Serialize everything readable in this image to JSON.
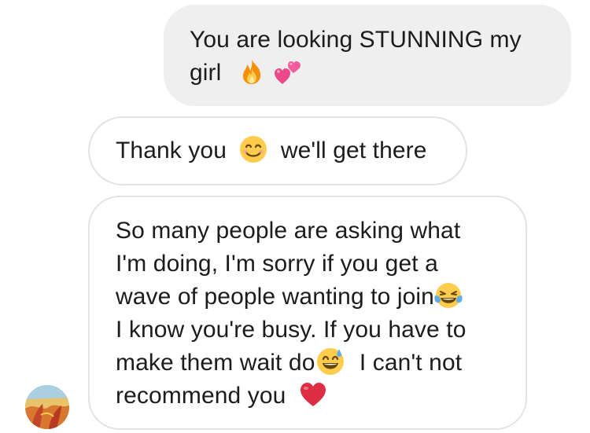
{
  "conversation": {
    "sent_message": {
      "line1": "You are looking STUNNING my",
      "line2_text": "girl",
      "line2_emojis": [
        "fire-emoji",
        "two-hearts-emoji"
      ]
    },
    "received_message_1": {
      "text_before": "Thank you",
      "emoji": "smiling-face-emoji",
      "text_after": "we'll get there"
    },
    "received_message_2": {
      "line1": "So many people are asking what",
      "line2": "I'm doing, I'm sorry if you get a",
      "line3": "wave of people wanting to join",
      "line3_emoji": "tears-of-joy-emoji",
      "line4": "I know you're busy. If you have to",
      "line5_before": "make them wait do",
      "line5_emoji": "grinning-sweat-emoji",
      "line5_after": " I can't not",
      "line6": "recommend you",
      "line6_emoji": "red-heart-emoji"
    }
  },
  "colors": {
    "sent_bubble_bg": "#efefef",
    "received_bubble_border": "#e3e3e3",
    "text": "#1c1c1e"
  }
}
